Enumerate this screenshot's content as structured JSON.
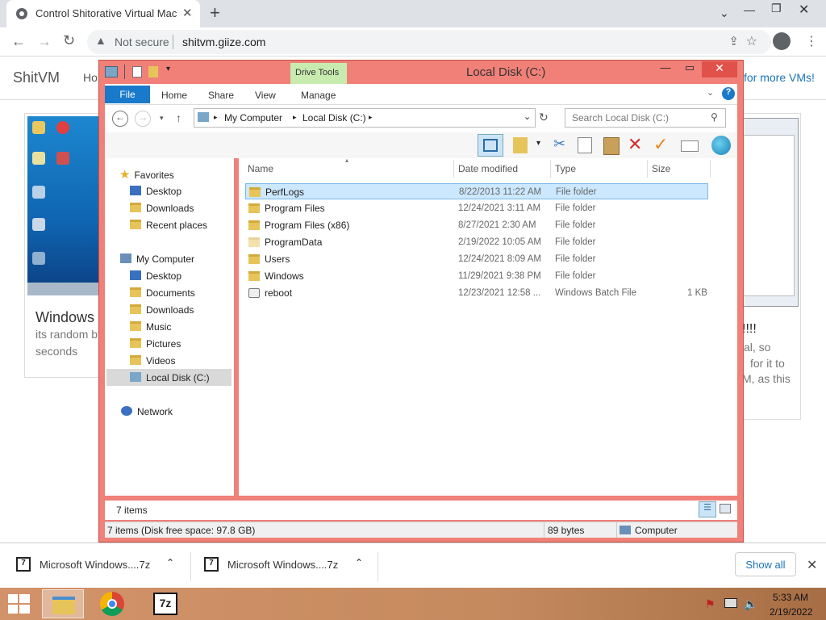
{
  "browser": {
    "tab_title": "Control Shitorative Virtual Machi",
    "security_label": "Not secure",
    "url": "shitvm.giize.com"
  },
  "site": {
    "brand": "ShitVM",
    "nav_fragment": "Ho",
    "more_vms_link": "for more VMs!",
    "left_card": {
      "title": "Windows",
      "desc_line1": "its random bt",
      "desc_line2": "seconds"
    },
    "right_card": {
      "headline": "!!!!",
      "line1": "al, so",
      "line2": "for it to",
      "line3": "M, as this"
    }
  },
  "explorer": {
    "window_title": "Local Disk (C:)",
    "contextual_tab": "Drive Tools",
    "ribbon_tabs": [
      "File",
      "Home",
      "Share",
      "View",
      "Manage"
    ],
    "breadcrumb": [
      "My Computer",
      "Local Disk (C:)"
    ],
    "search_placeholder": "Search Local Disk (C:)",
    "nav": {
      "favorites_label": "Favorites",
      "favorites": [
        "Desktop",
        "Downloads",
        "Recent places"
      ],
      "computer_label": "My Computer",
      "computer": [
        "Desktop",
        "Documents",
        "Downloads",
        "Music",
        "Pictures",
        "Videos",
        "Local Disk (C:)"
      ],
      "network_label": "Network"
    },
    "columns": {
      "name": "Name",
      "date": "Date modified",
      "type": "Type",
      "size": "Size"
    },
    "files": [
      {
        "name": "PerfLogs",
        "date": "8/22/2013 11:22 AM",
        "type": "File folder",
        "size": "",
        "selected": true
      },
      {
        "name": "Program Files",
        "date": "12/24/2021 3:11 AM",
        "type": "File folder",
        "size": ""
      },
      {
        "name": "Program Files (x86)",
        "date": "8/27/2021 2:30 AM",
        "type": "File folder",
        "size": ""
      },
      {
        "name": "ProgramData",
        "date": "2/19/2022 10:05 AM",
        "type": "File folder",
        "size": ""
      },
      {
        "name": "Users",
        "date": "12/24/2021 8:09 AM",
        "type": "File folder",
        "size": ""
      },
      {
        "name": "Windows",
        "date": "11/29/2021 9:38 PM",
        "type": "File folder",
        "size": ""
      },
      {
        "name": "reboot",
        "date": "12/23/2021 12:58 ...",
        "type": "Windows Batch File",
        "size": "1 KB"
      }
    ],
    "item_count": "7 items",
    "status_left": "7 items (Disk free space: 97.8 GB)",
    "status_mid": "89 bytes",
    "status_right": "Computer"
  },
  "downloads": {
    "item1": "Microsoft Windows....7z",
    "item2": "Microsoft Windows....7z",
    "show_all": "Show all"
  },
  "taskbar": {
    "time": "5:33 AM",
    "date": "2/19/2022",
    "zip_label": "7z"
  },
  "colors": {
    "window_frame": "#f08078",
    "selection": "#cce8ff",
    "file_tab": "#1979ca",
    "drive_tools": "#c8ecb0"
  }
}
